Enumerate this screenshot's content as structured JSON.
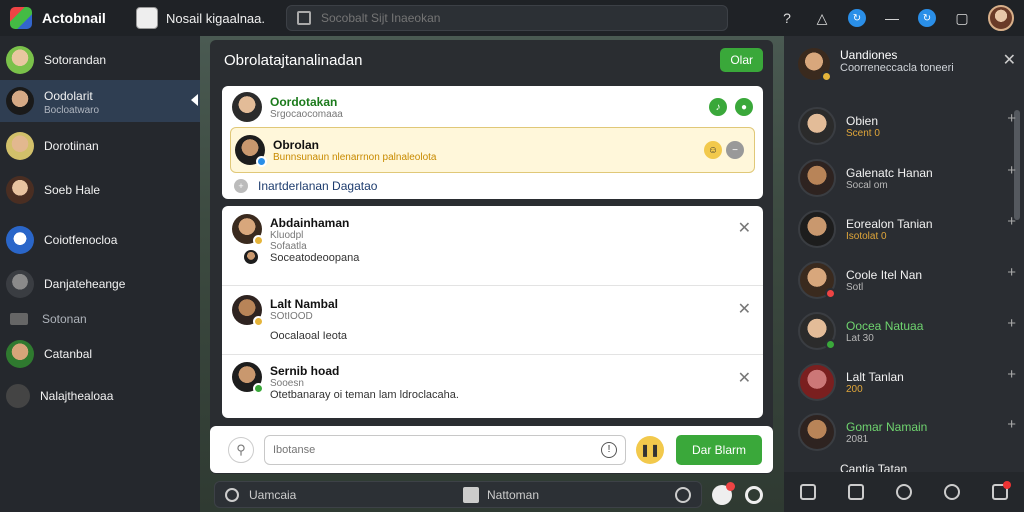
{
  "topbar": {
    "app_title": "Actobnail",
    "profile_label": "Nosail kigaalnaa.",
    "search_placeholder": "Socobalt Sijt Inaeokan"
  },
  "sidebar": {
    "items": [
      {
        "label": "Sotorandan",
        "sub": ""
      },
      {
        "label": "Oodolarit",
        "sub": "Bocloatwaro"
      },
      {
        "label": "Dorotiinan",
        "sub": ""
      },
      {
        "label": "Soeb Hale",
        "sub": ""
      },
      {
        "label": "Coiotfenocloa",
        "sub": ""
      },
      {
        "label": "Danjateheange",
        "sub": ""
      },
      {
        "label": "Sotonan",
        "sub": ""
      },
      {
        "label": "Catanbal",
        "sub": ""
      },
      {
        "label": "Nalajthealoaa",
        "sub": ""
      }
    ]
  },
  "panel": {
    "title": "Obrolatajtanalinadan",
    "header_button": "Olar",
    "card1": {
      "row1_name": "Oordotakan",
      "row1_sub": "Srgocaocomaaa",
      "row2_name": "Obrolan",
      "row2_sub": "Bunnsunaun nlenarrnon palnaleolota",
      "row3_text": "Inartderlanan Dagatao"
    },
    "entries": [
      {
        "name": "Abdainhaman",
        "sub1": "Kluodpl",
        "sub2": "Sofaatla",
        "body": "Soceatodeoopana"
      },
      {
        "name": "Lalt Nambal",
        "sub1": "SOtIOOD",
        "sub2": "",
        "body": "Oocalaoal Ieota"
      },
      {
        "name": "Sernib hoad",
        "sub1": "Sooesn",
        "sub2": "",
        "body": "Otetbanaray oi teman lam ldroclacaha."
      }
    ]
  },
  "composer": {
    "placeholder": "Ibotanse",
    "send_label": "Dar Blarm"
  },
  "bottom_bar": {
    "search_label": "Uamcaia",
    "nav_label": "Nattoman"
  },
  "right_panel": {
    "title": "Uandiones",
    "subtitle": "Coorreneccacla toneeri",
    "contacts": [
      {
        "name": "Obien",
        "sub": "Scent 0"
      },
      {
        "name": "Galenatc Hanan",
        "sub": "Socal om"
      },
      {
        "name": "Eorealon Tanian",
        "sub": "Isotolat 0"
      },
      {
        "name": "Coole Itel Nan",
        "sub": "Sotl"
      },
      {
        "name": "Oocea Natuaa",
        "sub": "Lat 30"
      },
      {
        "name": "Lalt Tanlan",
        "sub": "200"
      },
      {
        "name": "Gomar Namain",
        "sub": "2081"
      },
      {
        "name": "Cantia Tatan",
        "sub": ""
      }
    ]
  },
  "colors": {
    "accent_green": "#3aa83a",
    "sidebar_active": "#2f3e52",
    "highlight_bg": "#fff7da"
  }
}
